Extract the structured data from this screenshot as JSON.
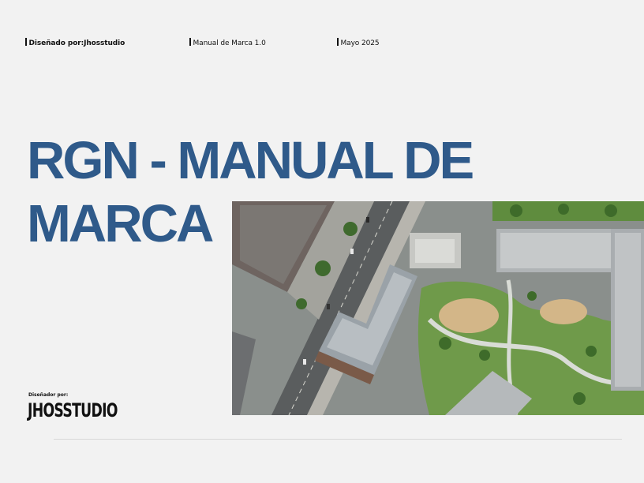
{
  "header": {
    "designed_by": "Diseñado por:Jhosstudio",
    "manual_version": "Manual de Marca 1.0",
    "date": "Mayo 2025"
  },
  "title": {
    "line1": "RGN - MANUAL DE",
    "line2": "MARCA"
  },
  "credit": {
    "label": "Diseñador por:",
    "logo_text": "JHOSSTUDIO"
  },
  "photo": {
    "description_icon": "aerial-city-photo"
  },
  "colors": {
    "title": "#2f5a8a",
    "background": "#f2f2f2"
  }
}
